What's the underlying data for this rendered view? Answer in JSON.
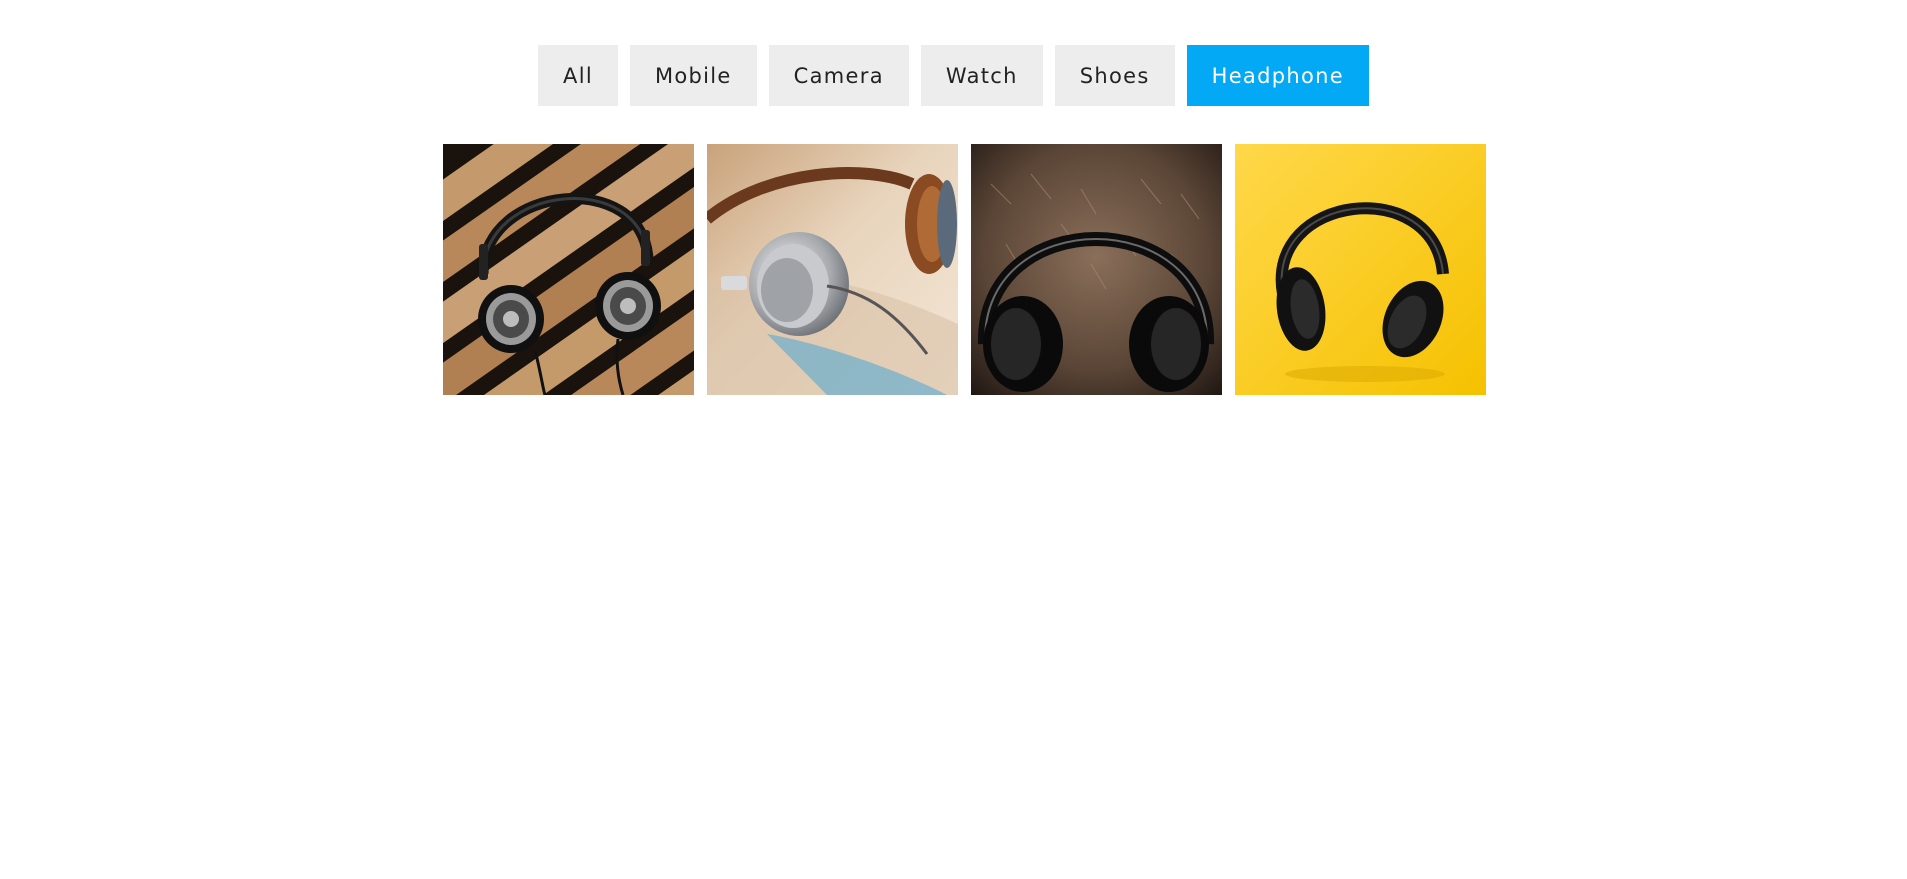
{
  "filters": {
    "items": [
      {
        "label": "All"
      },
      {
        "label": "Mobile"
      },
      {
        "label": "Camera"
      },
      {
        "label": "Watch"
      },
      {
        "label": "Shoes"
      },
      {
        "label": "Headphone"
      }
    ],
    "active": "Headphone",
    "active_color": "#03a9f4",
    "inactive_color": "#ededed"
  },
  "gallery": {
    "items": [
      {
        "subject": "headphone-on-wooden-slats-photo"
      },
      {
        "subject": "silver-headphone-closeup-photo"
      },
      {
        "subject": "headphone-on-fur-photo"
      },
      {
        "subject": "headphone-on-yellow-photo"
      }
    ]
  }
}
